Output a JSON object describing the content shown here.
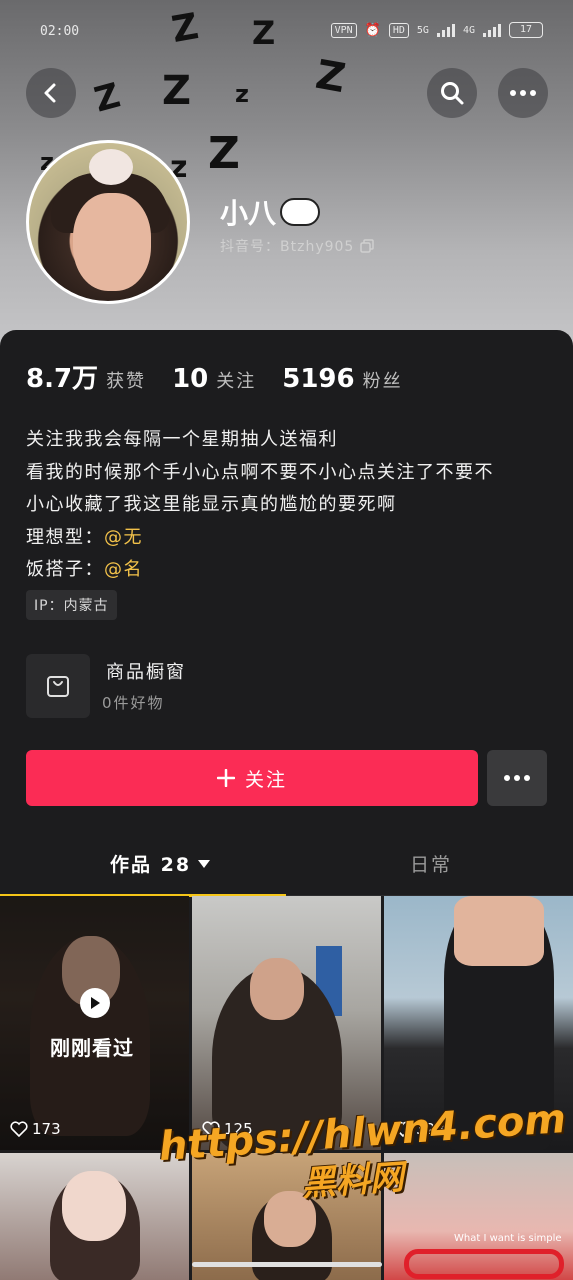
{
  "status_bar": {
    "time": "02:00",
    "vpn": "VPN",
    "hd": "HD",
    "net1": "5G",
    "net2": "4G",
    "battery": "17"
  },
  "profile": {
    "name": "小八",
    "douyin_id": "抖音号：Btzhy905",
    "stats": [
      {
        "value": "8.7万",
        "label": "获赞"
      },
      {
        "value": "10",
        "label": "关注"
      },
      {
        "value": "5196",
        "label": "粉丝"
      }
    ],
    "bio": {
      "line1": "关注我我会每隔一个星期抽人送福利",
      "line2": "看我的时候那个手小心点啊不要不小心点关注了不要不",
      "line3": "小心收藏了我这里能显示真的尴尬的要死啊",
      "ideal_label": "理想型：",
      "ideal_value": "@无",
      "partner_label": "饭搭子：",
      "partner_value": "@名"
    },
    "ip": "IP：内蒙古"
  },
  "shop": {
    "title": "商品橱窗",
    "subtitle": "0件好物"
  },
  "actions": {
    "follow": "关注"
  },
  "tabs": {
    "works": "作品 28",
    "daily": "日常"
  },
  "videos": [
    {
      "likes": "173",
      "overlay": "刚刚看过"
    },
    {
      "likes": "125"
    },
    {
      "likes": "328"
    },
    {
      "likes": ""
    },
    {
      "likes": ""
    },
    {
      "likes": "",
      "caption": "What I want is simple"
    }
  ],
  "watermark": {
    "url": "https://hlwn4.com",
    "cn": "黑料网"
  },
  "icons": [
    "back-icon",
    "search-icon",
    "more-icon",
    "copy-icon",
    "shopping-bag-icon",
    "plus-icon",
    "heart-icon",
    "play-icon",
    "dropdown-triangle-icon"
  ]
}
